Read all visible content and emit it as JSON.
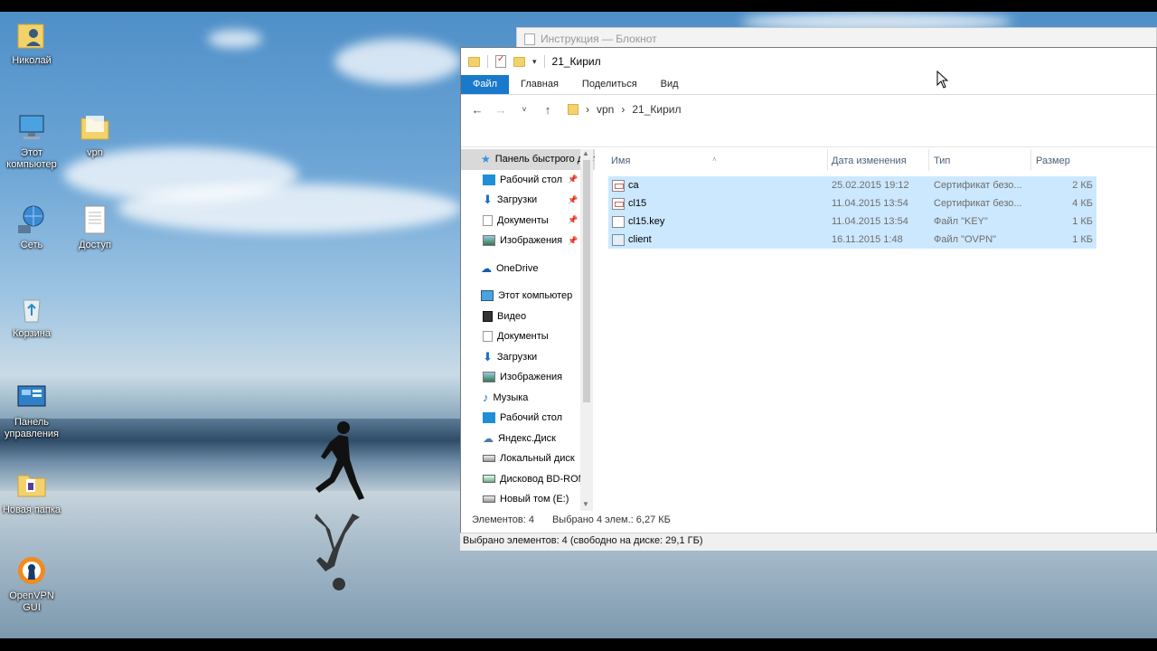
{
  "desktop": {
    "icons": [
      {
        "label": "Николай",
        "icon": "user-folder-icon"
      },
      {
        "label": "Этот компьютер",
        "icon": "computer-icon"
      },
      {
        "label": "vpn",
        "icon": "folder-icon"
      },
      {
        "label": "Сеть",
        "icon": "network-icon"
      },
      {
        "label": "Доступ",
        "icon": "text-document-icon"
      },
      {
        "label": "Корзина",
        "icon": "recycle-bin-icon"
      },
      {
        "label": "Панель управления",
        "icon": "control-panel-icon"
      },
      {
        "label": "Новая папка",
        "icon": "folder-icon"
      },
      {
        "label": "OpenVPN GUI",
        "icon": "openvpn-icon"
      }
    ]
  },
  "notepad": {
    "title": "Инструкция — Блокнот"
  },
  "explorer": {
    "title": "21_Кирил",
    "ribbon_tabs": [
      "Файл",
      "Главная",
      "Поделиться",
      "Вид"
    ],
    "address": {
      "sep": "›",
      "path": [
        "vpn",
        "21_Кирил"
      ]
    },
    "nav": {
      "quick_access": "Панель быстрого доступа",
      "quick_items": [
        "Рабочий стол",
        "Загрузки",
        "Документы",
        "Изображения"
      ],
      "onedrive": "OneDrive",
      "this_pc": "Этот компьютер",
      "pc_items": [
        "Видео",
        "Документы",
        "Загрузки",
        "Изображения",
        "Музыка",
        "Рабочий стол",
        "Яндекс.Диск",
        "Локальный диск",
        "Дисковод BD-ROM",
        "Новый том (E:)"
      ]
    },
    "columns": {
      "name": "Имя",
      "date": "Дата изменения",
      "type": "Тип",
      "size": "Размер"
    },
    "files": [
      {
        "name": "ca",
        "date": "25.02.2015 19:12",
        "type": "Сертификат безо...",
        "size": "2 КБ",
        "icon": "certificate-icon"
      },
      {
        "name": "cl15",
        "date": "11.04.2015 13:54",
        "type": "Сертификат безо...",
        "size": "4 КБ",
        "icon": "certificate-icon"
      },
      {
        "name": "cl15.key",
        "date": "11.04.2015 13:54",
        "type": "Файл \"KEY\"",
        "size": "1 КБ",
        "icon": "file-icon"
      },
      {
        "name": "client",
        "date": "16.11.2015 1:48",
        "type": "Файл \"OVPN\"",
        "size": "1 КБ",
        "icon": "ovpn-file-icon"
      }
    ],
    "status": {
      "count": "Элементов: 4",
      "selected": "Выбрано 4 элем.: 6,27 КБ"
    }
  },
  "footer": {
    "text": "Выбрано элементов: 4 (свободно на диске: 29,1 ГБ)"
  },
  "colors": {
    "ribbon_file": "#1979ca",
    "selection": "#cce8ff"
  }
}
